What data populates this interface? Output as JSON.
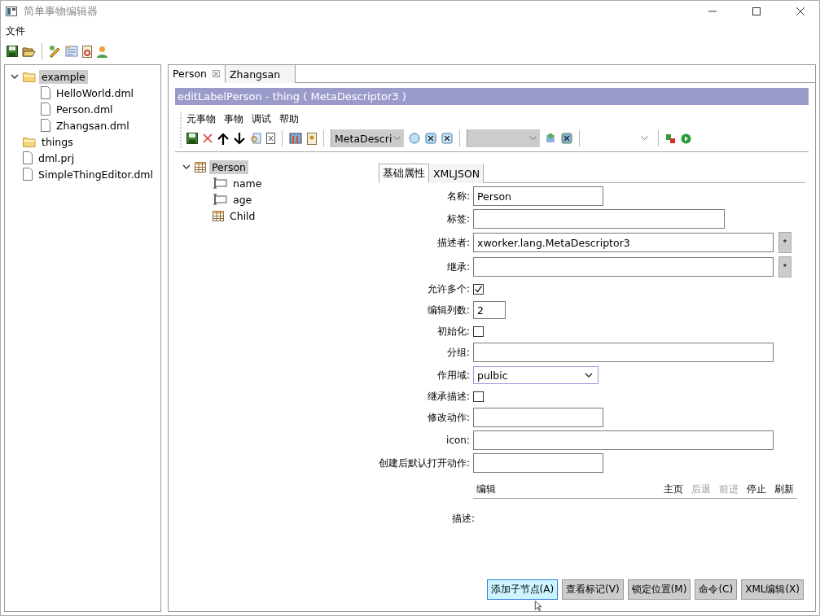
{
  "window": {
    "title": "简单事物编辑器"
  },
  "menu": [
    "文件"
  ],
  "file_tree": [
    {
      "label": "example",
      "kind": "folder",
      "expanded": true,
      "selected": true,
      "children": [
        {
          "label": "HelloWorld.dml",
          "kind": "file",
          "selected": false
        },
        {
          "label": "Person.dml",
          "kind": "file",
          "selected": false
        },
        {
          "label": "Zhangsan.dml",
          "kind": "file",
          "selected": false
        }
      ]
    },
    {
      "label": "things",
      "kind": "folder",
      "selected": false
    },
    {
      "label": "dml.prj",
      "kind": "file",
      "selected": false
    },
    {
      "label": "SimpleThingEditor.dml",
      "kind": "file",
      "selected": false
    }
  ],
  "editor_tabs": [
    {
      "label": "Person",
      "selected": true,
      "close": "☒"
    },
    {
      "label": "Zhangsan",
      "selected": false
    }
  ],
  "editor": {
    "header": "editLabelPerson - thing ( MetaDescriptor3 )",
    "menu": [
      "元事物",
      "事物",
      "调试",
      "帮助"
    ],
    "combo": "MetaDescri",
    "thing_tree": [
      {
        "label": "Person",
        "kind": "table",
        "expanded": true,
        "selected": true,
        "children": [
          {
            "label": "name",
            "kind": "field",
            "selected": false
          },
          {
            "label": "age",
            "kind": "field",
            "selected": false
          },
          {
            "label": "Child",
            "kind": "table",
            "selected": false
          }
        ]
      }
    ],
    "property_tabs": [
      {
        "label": "基础属性",
        "selected": true
      },
      {
        "label": "XMLJSON",
        "selected": false
      }
    ],
    "fields": [
      {
        "label": "名称:",
        "kind": "text",
        "value": "Person"
      },
      {
        "label": "标签:",
        "kind": "text"
      },
      {
        "label": "描述者:",
        "kind": "text",
        "value": "xworker.lang.MetaDescriptor3",
        "button": "*"
      },
      {
        "label": "继承:",
        "kind": "text",
        "button": "*"
      },
      {
        "label": "允许多个:",
        "kind": "check",
        "checked": true
      },
      {
        "label": "编辑列数:",
        "kind": "text",
        "value": "2"
      },
      {
        "label": "初始化:",
        "kind": "check",
        "checked": false
      },
      {
        "label": "分组:",
        "kind": "text"
      },
      {
        "label": "作用域:",
        "kind": "select",
        "value": "pulbic"
      },
      {
        "label": "继承描述:",
        "kind": "check",
        "checked": false
      },
      {
        "label": "修改动作:",
        "kind": "text"
      },
      {
        "label": "icon:",
        "kind": "text"
      },
      {
        "label": "创建后默认打开动作:",
        "kind": "text"
      }
    ],
    "description": {
      "label": "描述:",
      "edit": "编辑",
      "links": [
        {
          "label": "主页",
          "disabled": false
        },
        {
          "label": "后退",
          "disabled": true
        },
        {
          "label": "前进",
          "disabled": true
        },
        {
          "label": "停止",
          "disabled": false
        },
        {
          "label": "刷新",
          "disabled": false
        }
      ]
    },
    "buttons": [
      {
        "label": "添加子节点(A)",
        "focused": true
      },
      {
        "label": "查看标记(V)",
        "focused": false
      },
      {
        "label": "锁定位置(M)",
        "focused": false
      },
      {
        "label": "命令(C)",
        "focused": false
      },
      {
        "label": "XML编辑(X)",
        "focused": false
      }
    ]
  }
}
